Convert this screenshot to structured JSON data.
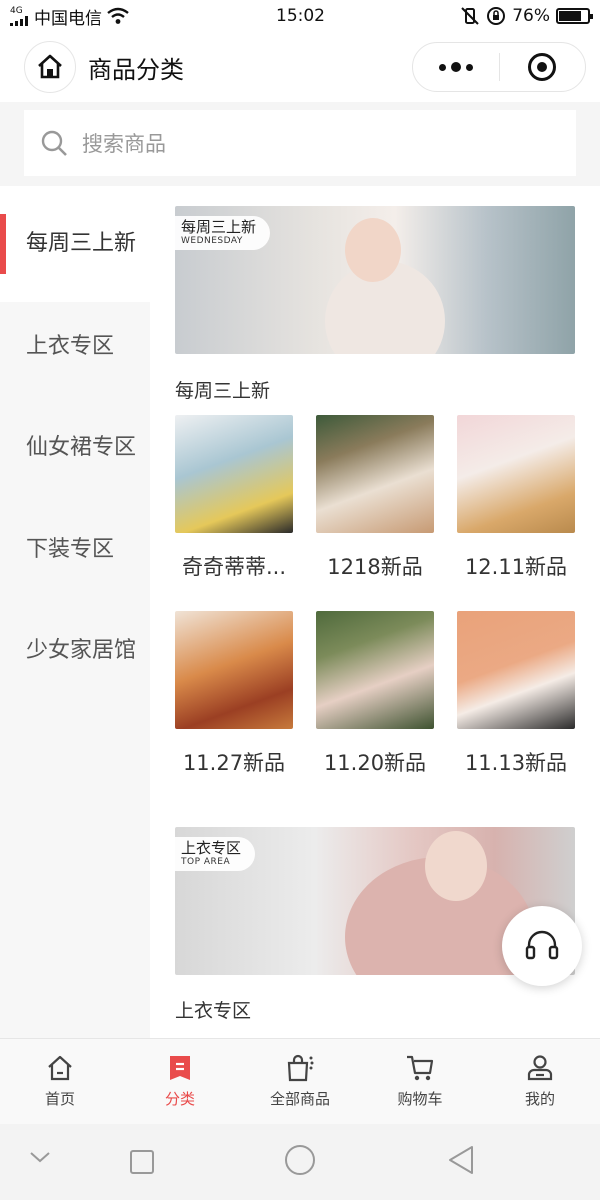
{
  "status": {
    "network": "4G",
    "carrier": "中国电信",
    "time": "15:02",
    "battery": "76%"
  },
  "nav": {
    "title": "商品分类"
  },
  "search": {
    "placeholder": "搜索商品"
  },
  "sidebar": {
    "items": [
      {
        "label": "每周三上新",
        "active": true
      },
      {
        "label": "上衣专区",
        "active": false
      },
      {
        "label": "仙女裙专区",
        "active": false
      },
      {
        "label": "下装专区",
        "active": false
      },
      {
        "label": "少女家居馆",
        "active": false
      }
    ]
  },
  "sections": [
    {
      "banner_cn": "每周三上新",
      "banner_en": "WEDNESDAY",
      "title": "每周三上新",
      "products": [
        {
          "label": "奇奇蒂蒂..."
        },
        {
          "label": "1218新品"
        },
        {
          "label": "12.11新品"
        },
        {
          "label": "11.27新品"
        },
        {
          "label": "11.20新品"
        },
        {
          "label": "11.13新品"
        }
      ]
    },
    {
      "banner_cn": "上衣专区",
      "banner_en": "TOP AREA",
      "title": "上衣专区"
    }
  ],
  "tabbar": {
    "tabs": [
      {
        "label": "首页",
        "icon": "home-icon",
        "active": false
      },
      {
        "label": "分类",
        "icon": "category-icon",
        "active": true
      },
      {
        "label": "全部商品",
        "icon": "shopping-bag-icon",
        "active": false
      },
      {
        "label": "购物车",
        "icon": "cart-icon",
        "active": false
      },
      {
        "label": "我的",
        "icon": "user-icon",
        "active": false
      }
    ]
  },
  "colors": {
    "accent": "#e94b4b",
    "sidebar_bg": "#f7f7f7",
    "page_bg": "#f5f5f5"
  }
}
